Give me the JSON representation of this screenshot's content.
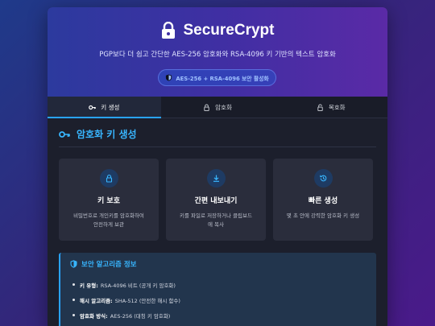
{
  "app": {
    "title": "SecureCrypt",
    "subtitle": "PGP보다 더 쉽고 간단한 AES-256 암호화와 RSA-4096 키 기반의 텍스트 암호화",
    "badge": "AES-256 + RSA-4096 보안 활성화"
  },
  "tabs": [
    {
      "label": "키 생성",
      "icon": "key-icon",
      "active": true
    },
    {
      "label": "암호화",
      "icon": "lock-icon",
      "active": false
    },
    {
      "label": "복호화",
      "icon": "unlock-icon",
      "active": false
    }
  ],
  "section": {
    "title": "암호화 키 생성",
    "icon": "key-icon"
  },
  "features": [
    {
      "title": "키 보호",
      "desc": "비밀번호로 개인키를 암호화하여 안전하게 보관",
      "icon": "lock-icon"
    },
    {
      "title": "간편 내보내기",
      "desc": "키를 파일로 저장하거나 클립보드에 복사",
      "icon": "download-icon"
    },
    {
      "title": "빠른 생성",
      "desc": "몇 초 안에 강력한 암호화 키 생성",
      "icon": "history-icon"
    }
  ],
  "info": {
    "title": "보안 알고리즘 정보",
    "items": [
      {
        "label": "키 유형:",
        "value": "RSA-4096 비트 (공개 키 암호화)"
      },
      {
        "label": "해시 알고리즘:",
        "value": "SHA-512 (안전한 해시 함수)"
      },
      {
        "label": "암호화 방식:",
        "value": "AES-256 (대칭 키 암호화)"
      }
    ]
  },
  "colors": {
    "accent": "#29a3ff",
    "card": "#1c1f2c",
    "feature_bg": "#2a2d3c"
  }
}
